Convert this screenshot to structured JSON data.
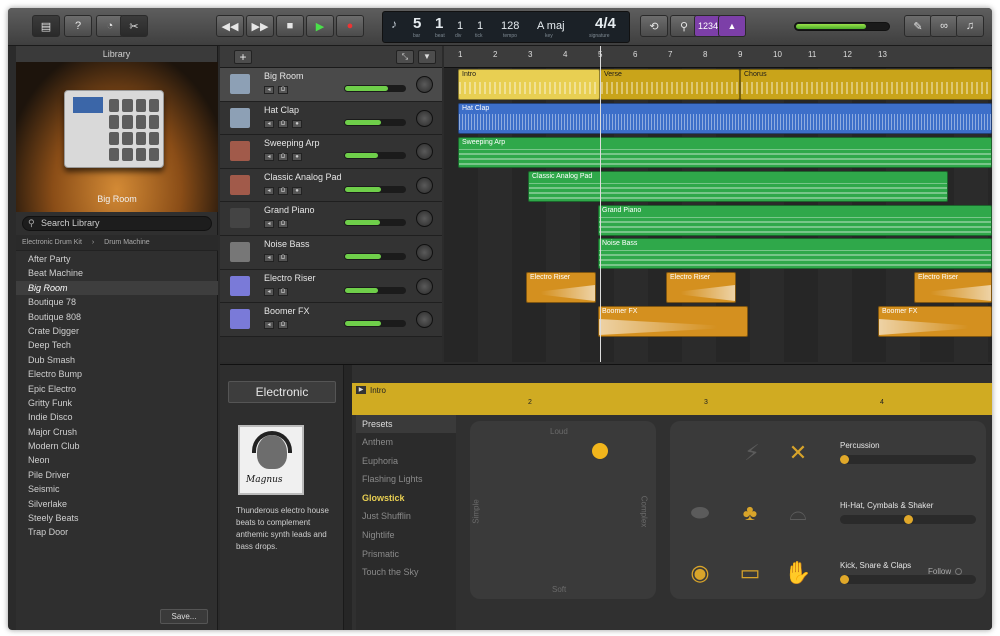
{
  "toolbar": {
    "lcd": {
      "bar": "5",
      "beat": "1",
      "div": "1",
      "tick": "1",
      "tempo": "128",
      "key": "A maj",
      "signature": "4/4",
      "cap_bar": "bar",
      "cap_beat": "beat",
      "cap_div": "div",
      "cap_tick": "tick",
      "cap_tempo": "tempo",
      "cap_key": "key",
      "cap_sig": "signature"
    },
    "count_in": "1234"
  },
  "library": {
    "title": "Library",
    "selected_patch": "Big Room",
    "search_placeholder": "Search Library",
    "breadcrumb": [
      "Electronic Drum Kit",
      "Drum Machine"
    ],
    "items": [
      "After Party",
      "Beat Machine",
      "Big Room",
      "Boutique 78",
      "Boutique 808",
      "Crate Digger",
      "Deep Tech",
      "Dub Smash",
      "Electro Bump",
      "Epic Electro",
      "Gritty Funk",
      "Indie Disco",
      "Major Crush",
      "Modern Club",
      "Neon",
      "Pile Driver",
      "Seismic",
      "Silverlake",
      "Steely Beats",
      "Trap Door"
    ],
    "selected_index": 2,
    "save_label": "Save..."
  },
  "tracks": [
    {
      "name": "Big Room",
      "volume": 0.72
    },
    {
      "name": "Hat Clap",
      "volume": 0.6
    },
    {
      "name": "Sweeping Arp",
      "volume": 0.55
    },
    {
      "name": "Classic Analog Pad",
      "volume": 0.6
    },
    {
      "name": "Grand Piano",
      "volume": 0.58
    },
    {
      "name": "Noise Bass",
      "volume": 0.6
    },
    {
      "name": "Electro Riser",
      "volume": 0.55
    },
    {
      "name": "Boomer FX",
      "volume": 0.6
    }
  ],
  "ruler": [
    "1",
    "2",
    "3",
    "4",
    "5",
    "6",
    "7",
    "8",
    "9",
    "10",
    "11",
    "12",
    "13"
  ],
  "regions": {
    "intro": "Intro",
    "verse": "Verse",
    "chorus": "Chorus",
    "hat_clap": "Hat Clap",
    "sweeping_arp": "Sweeping Arp",
    "classic_pad": "Classic Analog Pad",
    "grand_piano": "Grand Piano",
    "noise_bass": "Noise Bass",
    "electro_riser": "Electro Riser",
    "boomer_fx": "Boomer FX"
  },
  "editor": {
    "genre": "Electronic",
    "drummer_signature": "Magnus",
    "description": "Thunderous electro house beats to complement anthemic synth leads and bass drops.",
    "region_label": "Intro",
    "bars": [
      "2",
      "3",
      "4"
    ],
    "presets_title": "Presets",
    "presets": [
      "Anthem",
      "Euphoria",
      "Flashing Lights",
      "Glowstick",
      "Just Shufflin",
      "Nightlife",
      "Prismatic",
      "Touch the Sky"
    ],
    "selected_preset_index": 3,
    "xy_labels": {
      "top": "Loud",
      "bottom": "Soft",
      "left": "Simple",
      "right": "Complex"
    },
    "sliders": [
      {
        "label": "Percussion",
        "value": 0.0
      },
      {
        "label": "Hi-Hat, Cymbals & Shaker",
        "value": 0.5
      },
      {
        "label": "Kick, Snare & Claps",
        "value": 0.0
      }
    ],
    "follow_label": "Follow"
  },
  "colors": {
    "drummer_region": "#c9a41a",
    "audio_region": "#3d6fc9",
    "midi_region": "#2fa84a",
    "fx_region": "#d4901f",
    "accent": "#f1b51c"
  }
}
